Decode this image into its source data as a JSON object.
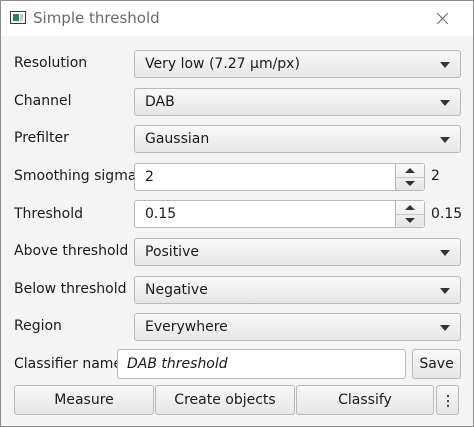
{
  "window": {
    "title": "Simple threshold"
  },
  "form": {
    "resolution": {
      "label": "Resolution",
      "value": "Very low (7.27 µm/px)"
    },
    "channel": {
      "label": "Channel",
      "value": "DAB"
    },
    "prefilter": {
      "label": "Prefilter",
      "value": "Gaussian"
    },
    "smoothing": {
      "label": "Smoothing sigma",
      "value": "2",
      "suffix": "2"
    },
    "threshold": {
      "label": "Threshold",
      "value": "0.15",
      "suffix": "0.15"
    },
    "above": {
      "label": "Above threshold",
      "value": "Positive"
    },
    "below": {
      "label": "Below threshold",
      "value": "Negative"
    },
    "region": {
      "label": "Region",
      "value": "Everywhere"
    },
    "classifier": {
      "label": "Classifier name",
      "value": "DAB threshold",
      "save_label": "Save"
    }
  },
  "actions": {
    "measure": "Measure",
    "create_objects": "Create objects",
    "classify": "Classify"
  },
  "icons": {
    "app": "qupath-window-icon",
    "close": "close-icon",
    "more": "more-options-icon"
  }
}
